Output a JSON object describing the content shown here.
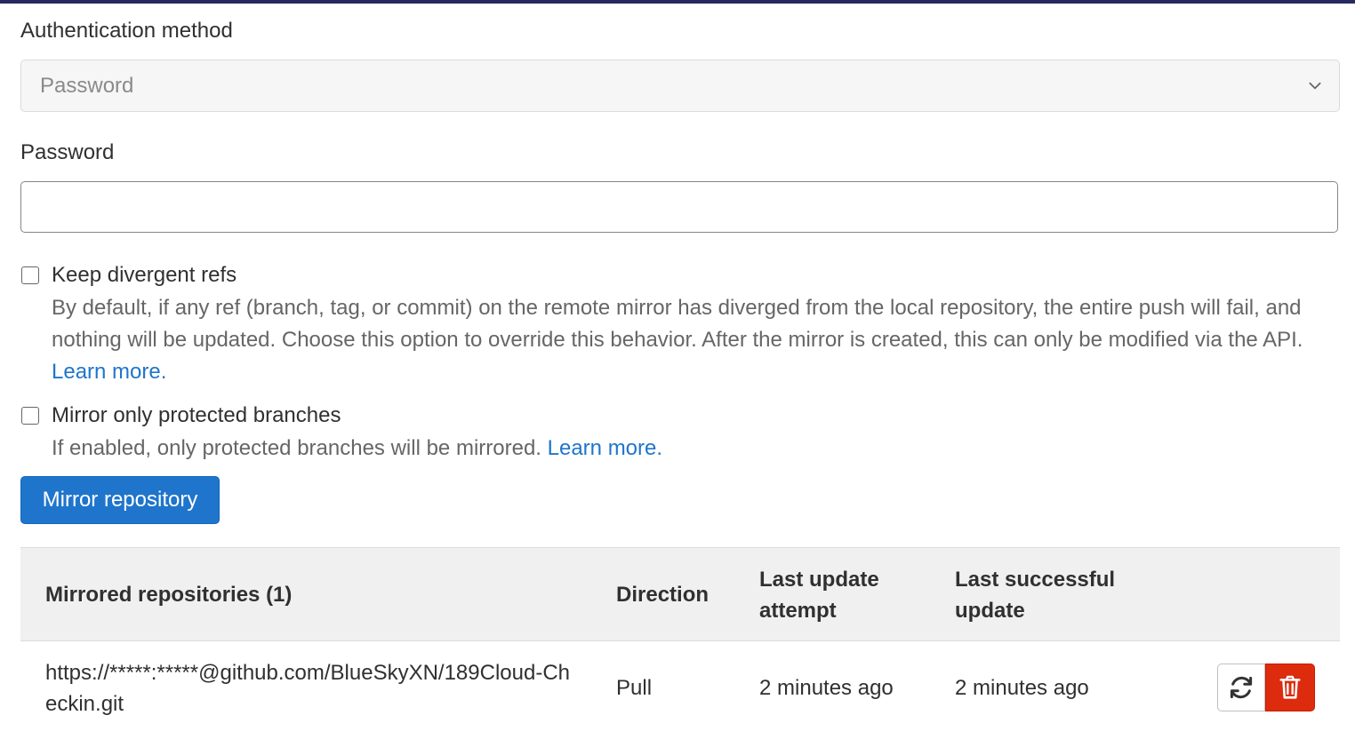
{
  "auth": {
    "label": "Authentication method",
    "selected": "Password"
  },
  "password": {
    "label": "Password",
    "value": ""
  },
  "keep_divergent": {
    "label": "Keep divergent refs",
    "help": "By default, if any ref (branch, tag, or commit) on the remote mirror has diverged from the local repository, the entire push will fail, and nothing will be updated. Choose this option to override this behavior. After the mirror is created, this can only be modified via the API.",
    "link": "Learn more."
  },
  "protected_only": {
    "label": "Mirror only protected branches",
    "help": "If enabled, only protected branches will be mirrored.",
    "link": "Learn more."
  },
  "mirror_button": "Mirror repository",
  "table": {
    "headers": {
      "repos": "Mirrored repositories (1)",
      "direction": "Direction",
      "last_attempt": "Last update attempt",
      "last_success": "Last successful update"
    },
    "rows": [
      {
        "url": "https://*****:*****@github.com/BlueSkyXN/189Cloud-Checkin.git",
        "direction": "Pull",
        "last_attempt": "2 minutes ago",
        "last_success": "2 minutes ago"
      }
    ]
  },
  "icons": {
    "select": "chevron-down-icon",
    "refresh": "refresh-icon",
    "delete": "trash-icon"
  },
  "colors": {
    "primary": "#1f75cb",
    "danger": "#dd2b0e",
    "header_bar": "#292961"
  }
}
